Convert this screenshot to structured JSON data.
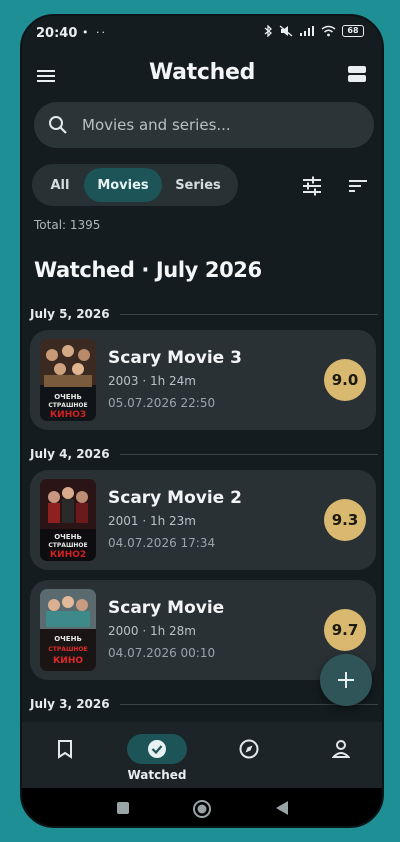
{
  "status": {
    "time": "20:40",
    "left_icons": "• ··",
    "battery": "68"
  },
  "topbar": {
    "title": "Watched",
    "menu_icon": "hamburger-icon",
    "layout_icon": "grid-view-icon"
  },
  "search": {
    "placeholder": "Movies and series..."
  },
  "segments": {
    "all": "All",
    "movies": "Movies",
    "series": "Series",
    "selected": "Movies"
  },
  "total": "Total: 1395",
  "heading": "Watched · July 2026",
  "groups": [
    {
      "date": "July 5, 2026"
    },
    {
      "date": "July 4, 2026"
    },
    {
      "date": "July 3, 2026"
    }
  ],
  "items": [
    {
      "title": "Scary Movie 3",
      "meta": "2003 · 1h 24m",
      "stamp": "05.07.2026 22:50",
      "rating": "9.0",
      "poster_text": "ОЧЕНЬ СТРАШНОЕ КИНО3"
    },
    {
      "title": "Scary Movie 2",
      "meta": "2001 · 1h 23m",
      "stamp": "04.07.2026 17:34",
      "rating": "9.3",
      "poster_text": "ОЧЕНЬ СТРАШНОЕ КИНО2"
    },
    {
      "title": "Scary Movie",
      "meta": "2000 · 1h 28m",
      "stamp": "04.07.2026 00:10",
      "rating": "9.7",
      "poster_text": "ОЧЕНЬ СТРАШНОЕ КИНО"
    }
  ],
  "nav": {
    "watched": "Watched"
  },
  "colors": {
    "accent": "#1c5457",
    "rating": "#d9b870",
    "background": "#141c1f"
  }
}
